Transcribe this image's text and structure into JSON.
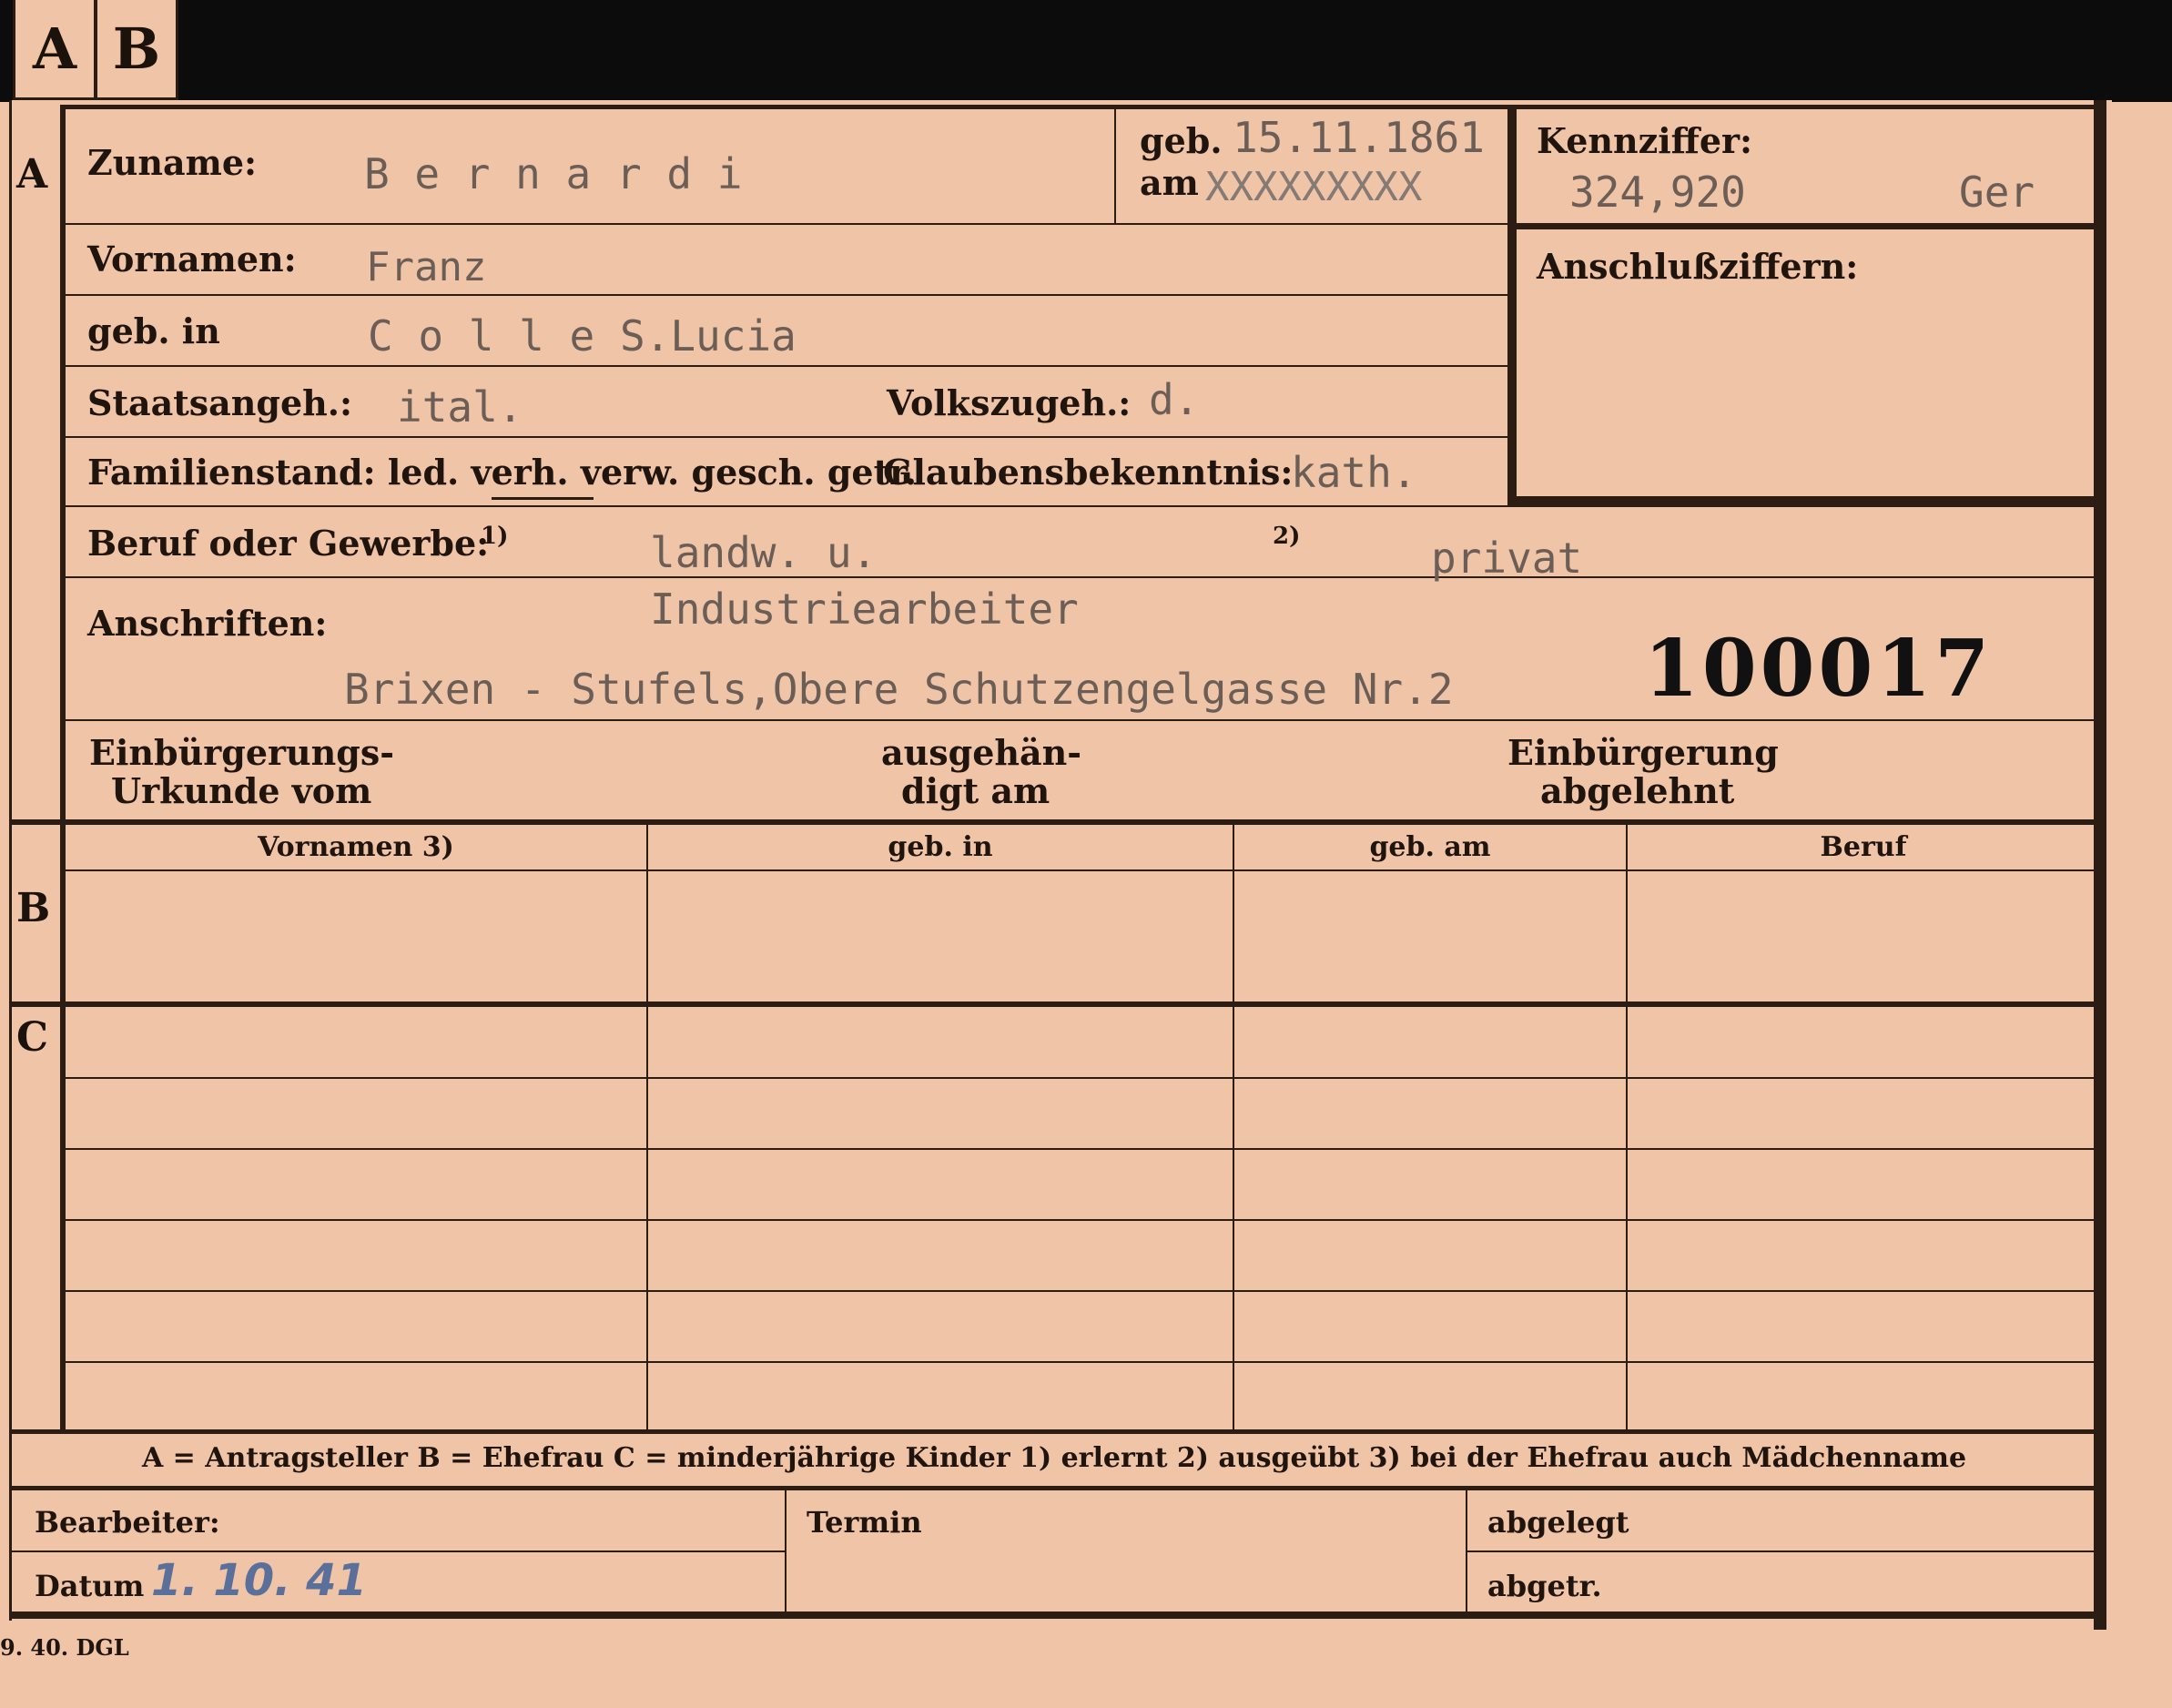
{
  "tabs": [
    "A",
    "B"
  ],
  "sections": {
    "a": "A",
    "b": "B",
    "c": "C"
  },
  "colors": {
    "paper": "#f0c4a6",
    "ink": "#20140e",
    "typewriter": "#6b5e57",
    "stamp_number": "#111111",
    "pencil_date": "#5a6f9a",
    "background": "#0c0c0c"
  },
  "person": {
    "surname_label": "Zuname:",
    "surname": "B e r n a r d i",
    "birth_label_top": "geb.",
    "birth_label_bottom": "am",
    "birth_date": "15.11.1861",
    "birth_date_struck": "XXXXXXXXX",
    "first_names_label": "Vornamen:",
    "first_names": "Franz",
    "birthplace_label": "geb. in",
    "birthplace": "C o l l e  S.Lucia",
    "citizenship_label": "Staatsangeh.:",
    "citizenship": "ital.",
    "ethnicity_label": "Volkszugeh.:",
    "ethnicity": "d.",
    "marital_label": "Familienstand: led. verh. verw. gesch. getr.",
    "religion_label": "Glaubensbekenntnis:",
    "religion": "kath."
  },
  "ids": {
    "code_label": "Kennziffer:",
    "code": "324,920",
    "code_suffix": "Ger",
    "linked_label": "Anschlußziffern:"
  },
  "occupation": {
    "label": "Beruf oder Gewerbe:",
    "note1": "1)",
    "learned": "landw. u.",
    "learned_line2": "Industriearbeiter",
    "note2": "2)",
    "practiced": "privat"
  },
  "address": {
    "label": "Anschriften:",
    "value": "Brixen - Stufels,Obere Schutzengelgasse Nr.2",
    "number": "100017"
  },
  "naturalization": {
    "doc_line1": "Einbürgerungs-",
    "doc_line2": "Urkunde vom",
    "handed_line1": "ausgehän-",
    "handed_line2": "digt am",
    "refused_line1": "Einbürgerung",
    "refused_line2": "abgelehnt"
  },
  "table": {
    "headers": [
      "Vornamen 3)",
      "geb. in",
      "geb. am",
      "Beruf"
    ]
  },
  "legend": "A = Antragsteller   B = Ehefrau   C = minderjährige Kinder   1) erlernt   2) ausgeübt   3) bei der Ehefrau auch Mädchenname",
  "footer": {
    "clerk_label": "Bearbeiter:",
    "date_label": "Datum",
    "date_value": "1. 10. 41",
    "deadline_label": "Termin",
    "filed_label": "abgelegt",
    "sent_label": "abgetr.",
    "print_code": "9. 40. DGL"
  }
}
